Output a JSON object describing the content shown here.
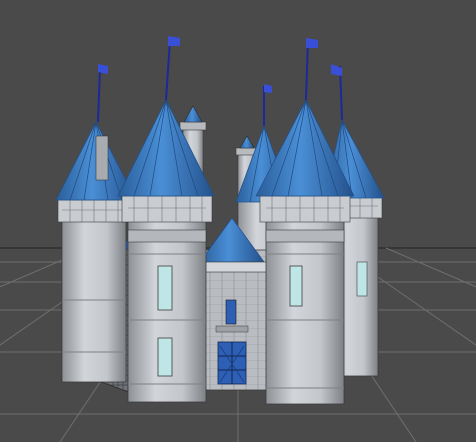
{
  "viewport": {
    "kind": "3d-perspective-viewport",
    "background": "#4a4a4a",
    "grid_color": "#6f6f6f",
    "horizon_color": "#2a2a2a"
  },
  "model": {
    "name": "castle",
    "roof_color": "#3d7fc4",
    "roof_shade": "#2a5e9a",
    "wall_color": "#c9ccd0",
    "wall_shade": "#9a9ea4",
    "window_color": "#bfe6e6",
    "flag_color": "#3a4fd8",
    "pole_color": "#1a2a9a",
    "gate_color": "#2d5fb4",
    "edge_color": "#3b3b3b"
  }
}
